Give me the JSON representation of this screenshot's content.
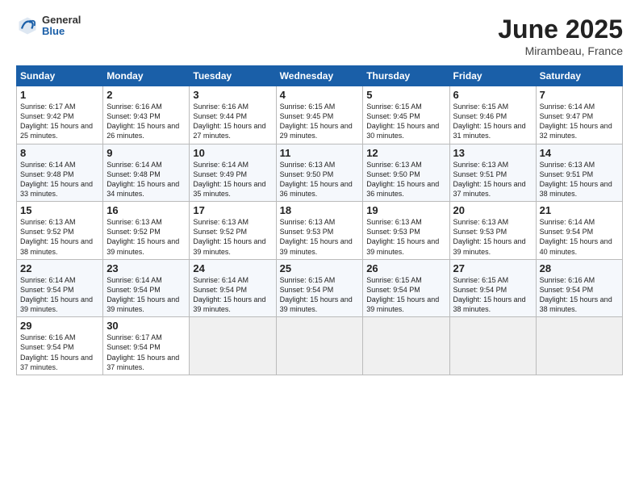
{
  "header": {
    "logo_general": "General",
    "logo_blue": "Blue",
    "month_title": "June 2025",
    "location": "Mirambeau, France"
  },
  "weekdays": [
    "Sunday",
    "Monday",
    "Tuesday",
    "Wednesday",
    "Thursday",
    "Friday",
    "Saturday"
  ],
  "weeks": [
    [
      {
        "day": "1",
        "sunrise": "6:17 AM",
        "sunset": "9:42 PM",
        "daylight": "15 hours and 25 minutes."
      },
      {
        "day": "2",
        "sunrise": "6:16 AM",
        "sunset": "9:43 PM",
        "daylight": "15 hours and 26 minutes."
      },
      {
        "day": "3",
        "sunrise": "6:16 AM",
        "sunset": "9:44 PM",
        "daylight": "15 hours and 27 minutes."
      },
      {
        "day": "4",
        "sunrise": "6:15 AM",
        "sunset": "9:45 PM",
        "daylight": "15 hours and 29 minutes."
      },
      {
        "day": "5",
        "sunrise": "6:15 AM",
        "sunset": "9:45 PM",
        "daylight": "15 hours and 30 minutes."
      },
      {
        "day": "6",
        "sunrise": "6:15 AM",
        "sunset": "9:46 PM",
        "daylight": "15 hours and 31 minutes."
      },
      {
        "day": "7",
        "sunrise": "6:14 AM",
        "sunset": "9:47 PM",
        "daylight": "15 hours and 32 minutes."
      }
    ],
    [
      {
        "day": "8",
        "sunrise": "6:14 AM",
        "sunset": "9:48 PM",
        "daylight": "15 hours and 33 minutes."
      },
      {
        "day": "9",
        "sunrise": "6:14 AM",
        "sunset": "9:48 PM",
        "daylight": "15 hours and 34 minutes."
      },
      {
        "day": "10",
        "sunrise": "6:14 AM",
        "sunset": "9:49 PM",
        "daylight": "15 hours and 35 minutes."
      },
      {
        "day": "11",
        "sunrise": "6:13 AM",
        "sunset": "9:50 PM",
        "daylight": "15 hours and 36 minutes."
      },
      {
        "day": "12",
        "sunrise": "6:13 AM",
        "sunset": "9:50 PM",
        "daylight": "15 hours and 36 minutes."
      },
      {
        "day": "13",
        "sunrise": "6:13 AM",
        "sunset": "9:51 PM",
        "daylight": "15 hours and 37 minutes."
      },
      {
        "day": "14",
        "sunrise": "6:13 AM",
        "sunset": "9:51 PM",
        "daylight": "15 hours and 38 minutes."
      }
    ],
    [
      {
        "day": "15",
        "sunrise": "6:13 AM",
        "sunset": "9:52 PM",
        "daylight": "15 hours and 38 minutes."
      },
      {
        "day": "16",
        "sunrise": "6:13 AM",
        "sunset": "9:52 PM",
        "daylight": "15 hours and 39 minutes."
      },
      {
        "day": "17",
        "sunrise": "6:13 AM",
        "sunset": "9:52 PM",
        "daylight": "15 hours and 39 minutes."
      },
      {
        "day": "18",
        "sunrise": "6:13 AM",
        "sunset": "9:53 PM",
        "daylight": "15 hours and 39 minutes."
      },
      {
        "day": "19",
        "sunrise": "6:13 AM",
        "sunset": "9:53 PM",
        "daylight": "15 hours and 39 minutes."
      },
      {
        "day": "20",
        "sunrise": "6:13 AM",
        "sunset": "9:53 PM",
        "daylight": "15 hours and 39 minutes."
      },
      {
        "day": "21",
        "sunrise": "6:14 AM",
        "sunset": "9:54 PM",
        "daylight": "15 hours and 40 minutes."
      }
    ],
    [
      {
        "day": "22",
        "sunrise": "6:14 AM",
        "sunset": "9:54 PM",
        "daylight": "15 hours and 39 minutes."
      },
      {
        "day": "23",
        "sunrise": "6:14 AM",
        "sunset": "9:54 PM",
        "daylight": "15 hours and 39 minutes."
      },
      {
        "day": "24",
        "sunrise": "6:14 AM",
        "sunset": "9:54 PM",
        "daylight": "15 hours and 39 minutes."
      },
      {
        "day": "25",
        "sunrise": "6:15 AM",
        "sunset": "9:54 PM",
        "daylight": "15 hours and 39 minutes."
      },
      {
        "day": "26",
        "sunrise": "6:15 AM",
        "sunset": "9:54 PM",
        "daylight": "15 hours and 39 minutes."
      },
      {
        "day": "27",
        "sunrise": "6:15 AM",
        "sunset": "9:54 PM",
        "daylight": "15 hours and 38 minutes."
      },
      {
        "day": "28",
        "sunrise": "6:16 AM",
        "sunset": "9:54 PM",
        "daylight": "15 hours and 38 minutes."
      }
    ],
    [
      {
        "day": "29",
        "sunrise": "6:16 AM",
        "sunset": "9:54 PM",
        "daylight": "15 hours and 37 minutes."
      },
      {
        "day": "30",
        "sunrise": "6:17 AM",
        "sunset": "9:54 PM",
        "daylight": "15 hours and 37 minutes."
      },
      null,
      null,
      null,
      null,
      null
    ]
  ]
}
